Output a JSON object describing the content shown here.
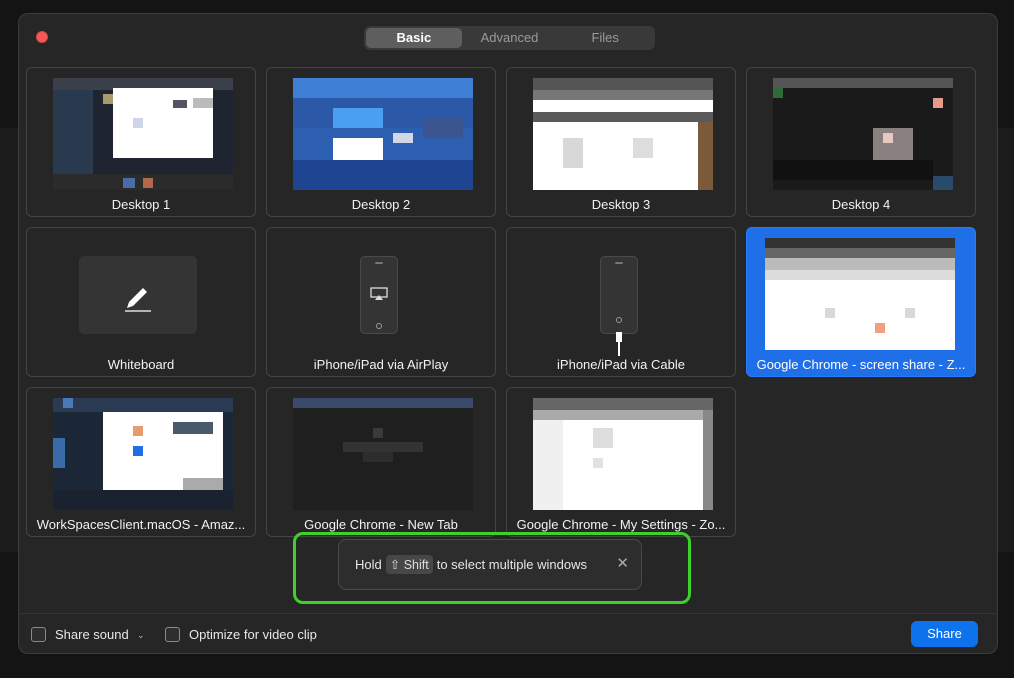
{
  "tabs": [
    "Basic",
    "Advanced",
    "Files"
  ],
  "tiles": [
    {
      "label": "Desktop 1"
    },
    {
      "label": "Desktop 2"
    },
    {
      "label": "Desktop 3"
    },
    {
      "label": "Desktop 4"
    },
    {
      "label": "Whiteboard"
    },
    {
      "label": "iPhone/iPad via AirPlay"
    },
    {
      "label": "iPhone/iPad via Cable"
    },
    {
      "label": "Google Chrome - screen share - Z..."
    },
    {
      "label": "WorkSpacesClient.macOS - Amaz..."
    },
    {
      "label": "Google Chrome - New Tab"
    },
    {
      "label": "Google Chrome - My Settings - Zo..."
    }
  ],
  "hint": {
    "pre": "Hold",
    "key": "⇧ Shift",
    "post": "to select multiple windows",
    "close": "✕"
  },
  "footer": {
    "share_sound": "Share sound",
    "optimize": "Optimize for video clip",
    "share": "Share"
  },
  "colors": {
    "accent": "#0e72ed",
    "selected_tile": "#1f6fe8",
    "hint_ring": "#3ed12c"
  }
}
